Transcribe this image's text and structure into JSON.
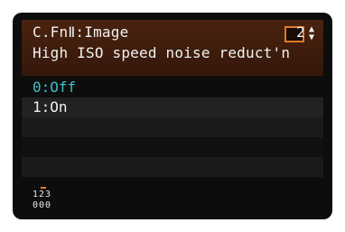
{
  "header": {
    "title": "C.FnⅡ:Image",
    "subtitle": "High ISO speed noise reduct'n",
    "number": "2",
    "spinner_icon": "up-down-arrows-icon"
  },
  "options": [
    {
      "label": "0:Off",
      "selected": true
    },
    {
      "label": "1:On",
      "selected": false
    }
  ],
  "footer": {
    "indices": "123",
    "values": "000",
    "marker_index": 2
  },
  "colors": {
    "header_bg": "#3a1a0d",
    "selected_text": "#3ec1c9",
    "accent": "#e07a2a"
  }
}
